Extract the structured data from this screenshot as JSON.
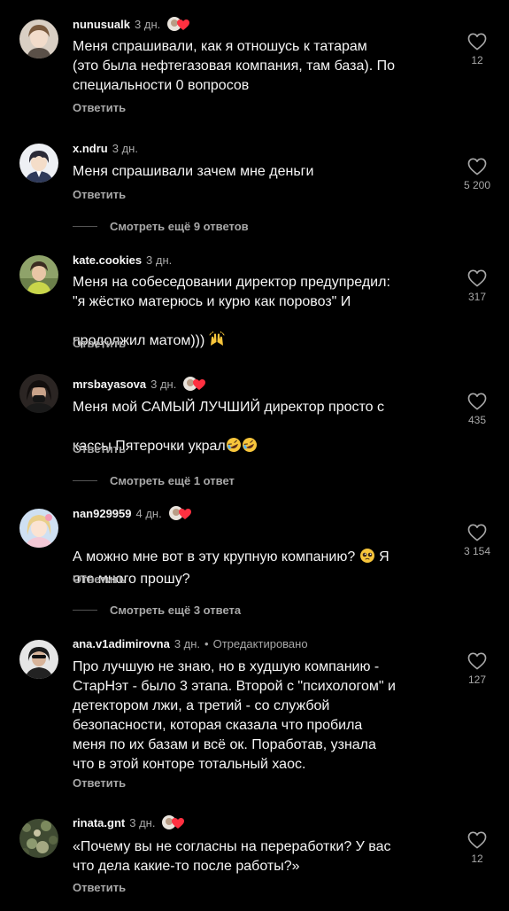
{
  "comments": [
    {
      "username": "nunusualk",
      "time": "3 дн.",
      "text": "Меня спрашивали, как я отношусь к татарам\n(это была нефтегазовая компания, там база). По\nспециальности 0 вопросов",
      "reply": "Ответить",
      "likes": "12",
      "author_liked": true
    },
    {
      "username": "x.ndru",
      "time": "3 дн.",
      "text": "Меня спрашивали зачем мне деньги",
      "reply": "Ответить",
      "likes": "5 200",
      "author_liked": false
    },
    {
      "username": "kate.cookies",
      "time": "3 дн.",
      "text": "Меня на собеседовании директор предупредил:\n\"я жёстко матерюсь и курю как поровоз\" И\nпродолжил матом)))",
      "emoji_after_text": "🙌",
      "reply": "Ответить",
      "likes": "317",
      "author_liked": false
    },
    {
      "username": "mrsbayasova",
      "time": "3 дн.",
      "text": "Меня мой САМЫЙ ЛУЧШИЙ директор просто с\nкассы Пятерочки украл",
      "emoji_after_text": "🤣🤣",
      "reply": "Ответить",
      "likes": "435",
      "author_liked": true
    },
    {
      "username": "nan929959",
      "time": "4 дн.",
      "text_part1": "А можно мне вот в эту крупную компанию?",
      "text_emoji": "🥺",
      "text_part2": "Я",
      "text_line2": "что много прошу?",
      "reply": "Ответить",
      "likes": "3 154",
      "author_liked": true
    },
    {
      "username": "ana.v1adimirovna",
      "time": "3 дн.",
      "edited": "Отредактировано",
      "text": "Про лучшую не знаю, но в худшую компанию -\nСтарНэт - было 3 этапа. Второй с \"психологом\" и\nдетектором лжи, а третий - со службой\nбезопасности, которая сказала что пробила\nменя по их базам и всё ок. Поработав, узнала\nчто в этой конторе тотальный хаос.",
      "reply": "Ответить",
      "likes": "127",
      "author_liked": false
    },
    {
      "username": "rinata.gnt",
      "time": "3 дн.",
      "text": "«Почему вы не согласны на переработки? У вас\nчто дела какие-то после работы?»",
      "reply": "Ответить",
      "likes": "12",
      "author_liked": true
    }
  ],
  "view_more": [
    "Смотреть ещё 9 ответов",
    "Смотреть ещё 1 ответ",
    "Смотреть ещё 3 ответа"
  ],
  "colors": {
    "background": "#000000",
    "text": "#f5f5f5",
    "secondary": "#a8a8a8",
    "heart_red": "#ff3040"
  }
}
